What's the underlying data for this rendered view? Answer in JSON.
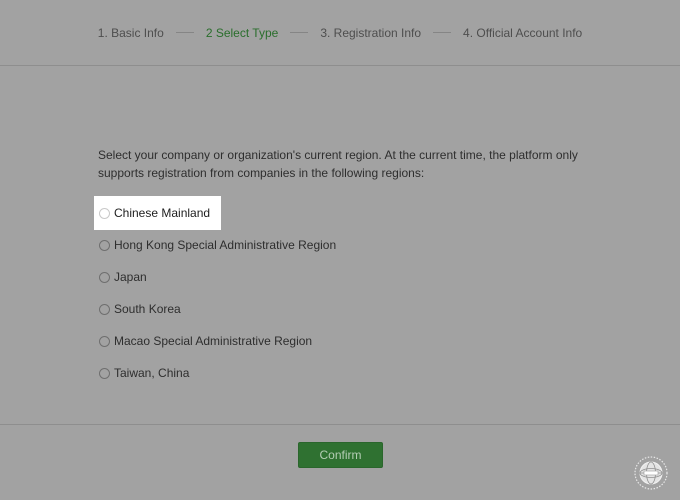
{
  "stepper": {
    "steps": [
      {
        "label": "1. Basic Info"
      },
      {
        "label": "2 Select Type"
      },
      {
        "label": "3. Registration Info"
      },
      {
        "label": "4. Official Account Info"
      }
    ],
    "active_step": 2
  },
  "main": {
    "intro": "Select your company or organization's current region. At the current time, the platform only supports registration from companies in the following regions:",
    "regions": [
      {
        "label": "Chinese Mainland",
        "highlighted": true
      },
      {
        "label": "Hong Kong Special Administrative Region"
      },
      {
        "label": "Japan"
      },
      {
        "label": "South Korea"
      },
      {
        "label": "Macao Special Administrative Region"
      },
      {
        "label": "Taiwan, China"
      }
    ]
  },
  "footer": {
    "confirm_label": "Confirm"
  },
  "colors": {
    "overlay": "#a2a2a2",
    "accent": "#2f7131",
    "active_step": "#2a6e2c"
  },
  "icons": {
    "watermark": "globe-seal-icon"
  }
}
